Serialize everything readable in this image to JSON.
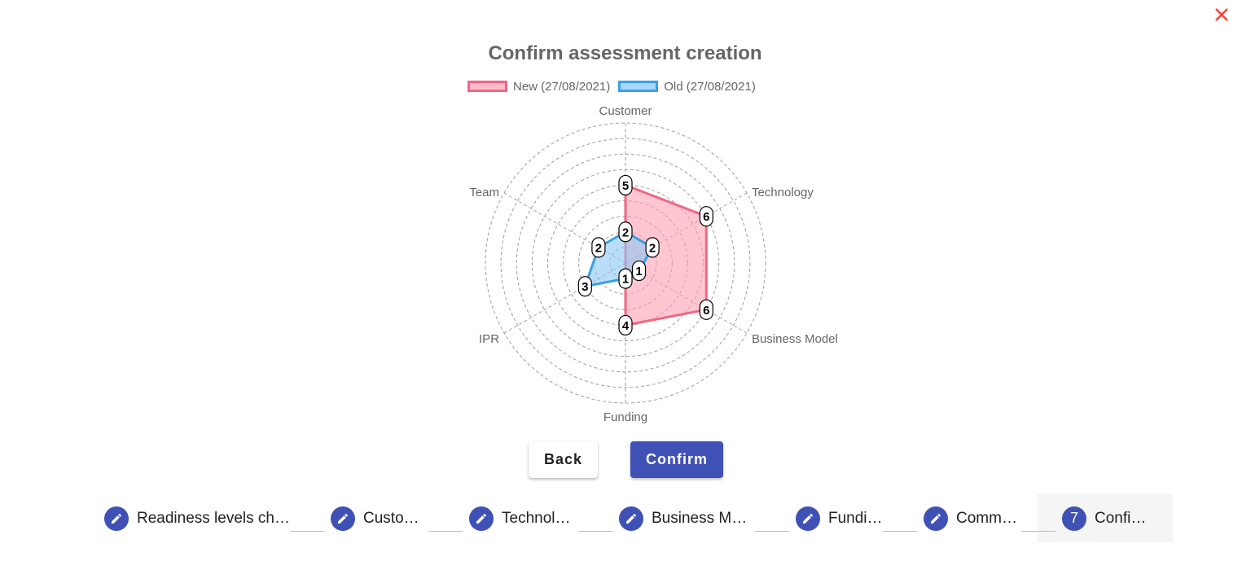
{
  "dialog": {
    "close_icon": "close-icon",
    "close_color": "#f44336"
  },
  "chart_data": {
    "type": "radar",
    "title": "Confirm assessment creation",
    "axes": [
      "Customer",
      "Technology",
      "Business Model",
      "Funding",
      "IPR",
      "Team"
    ],
    "range": [
      0,
      9
    ],
    "grid": true,
    "legend_position": "top",
    "series": [
      {
        "name": "New (27/08/2021)",
        "values": [
          5,
          6,
          6,
          4,
          0,
          0
        ],
        "border_color": "#f06783",
        "fill_color": "rgba(255,160,180,0.6)"
      },
      {
        "name": "Old (27/08/2021)",
        "values": [
          2,
          2,
          1,
          1,
          3,
          2
        ],
        "border_color": "#3aa0e6",
        "fill_color": "rgba(140,200,245,0.6)"
      }
    ]
  },
  "actions": {
    "back_label": "Back",
    "confirm_label": "Confirm",
    "primary_color": "#3f51b5"
  },
  "stepper": {
    "steps": [
      {
        "label": "Readiness levels ch…",
        "icon": "edit-icon",
        "number": ""
      },
      {
        "label": "Custo…",
        "icon": "edit-icon",
        "number": ""
      },
      {
        "label": "Technol…",
        "icon": "edit-icon",
        "number": ""
      },
      {
        "label": "Business M…",
        "icon": "edit-icon",
        "number": ""
      },
      {
        "label": "Fundi…",
        "icon": "edit-icon",
        "number": ""
      },
      {
        "label": "Comm…",
        "icon": "edit-icon",
        "number": ""
      },
      {
        "label": "Confi…",
        "icon": "",
        "number": "7"
      }
    ]
  }
}
